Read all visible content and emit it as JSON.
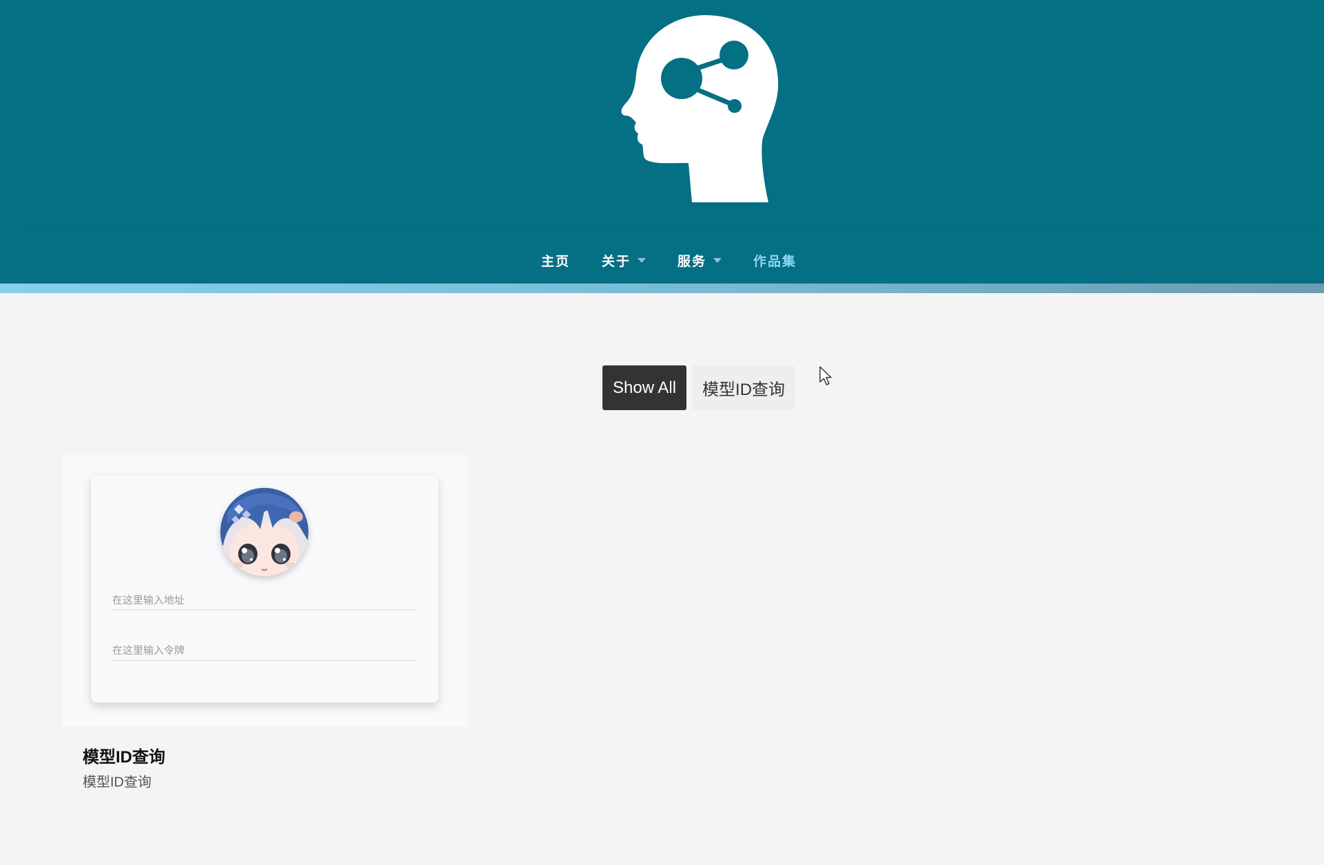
{
  "colors": {
    "header_bg": "#056f84",
    "accent_gradient": [
      "#87cfe8",
      "#6a9cb2"
    ],
    "nav_text": "#ffffff",
    "nav_active": "#8fd6ee",
    "filter_active_bg": "#333333",
    "filter_inactive_bg": "#eeeeee",
    "page_bg": "#f4f4f4"
  },
  "header": {
    "logo_icon": "head-network-icon"
  },
  "nav": {
    "items": [
      {
        "label": "主页",
        "has_dropdown": false,
        "active": false
      },
      {
        "label": "关于",
        "has_dropdown": true,
        "active": false
      },
      {
        "label": "服务",
        "has_dropdown": true,
        "active": false
      },
      {
        "label": "作品集",
        "has_dropdown": false,
        "active": true
      }
    ]
  },
  "filters": {
    "show_all": "Show All",
    "model_id": "模型ID查询",
    "selected": "Show All"
  },
  "portfolio": {
    "items": [
      {
        "title": "模型ID查询",
        "subtitle": "模型ID查询",
        "preview": {
          "avatar_icon": "anime-avatar-icon",
          "address_placeholder": "在这里输入地址",
          "token_placeholder": "在这里输入令牌"
        }
      }
    ]
  }
}
